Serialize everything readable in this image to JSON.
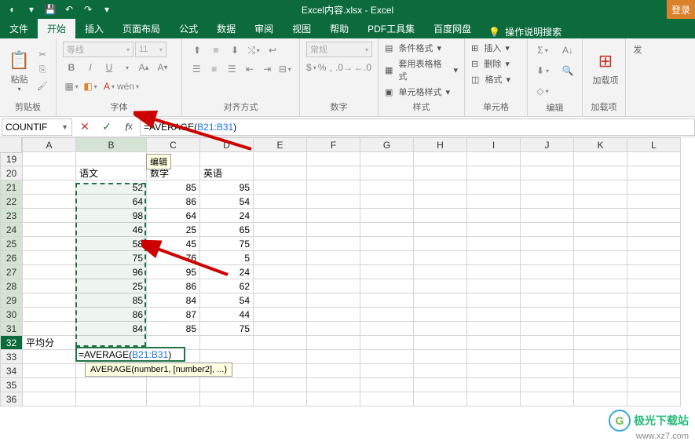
{
  "app": {
    "title": "Excel内容.xlsx - Excel",
    "login": "登录"
  },
  "tabs": {
    "file": "文件",
    "home": "开始",
    "insert": "插入",
    "layout": "页面布局",
    "formula": "公式",
    "data": "数据",
    "review": "审阅",
    "view": "视图",
    "help": "帮助",
    "pdf": "PDF工具集",
    "baidu": "百度网盘",
    "search": "操作说明搜索"
  },
  "ribbon": {
    "clipboard": {
      "label": "剪贴板",
      "paste": "粘贴"
    },
    "font": {
      "label": "字体",
      "name": "等线",
      "size": "11"
    },
    "align": {
      "label": "对齐方式"
    },
    "number": {
      "label": "数字",
      "format": "常规"
    },
    "styles": {
      "label": "样式",
      "cond": "条件格式",
      "table": "套用表格格式",
      "cell": "单元格样式"
    },
    "cells": {
      "label": "单元格",
      "insert": "插入",
      "delete": "删除",
      "format": "格式"
    },
    "edit": {
      "label": "编辑"
    },
    "addins": {
      "label": "加载项",
      "btn": "加载项"
    },
    "publish": {
      "label": "发"
    }
  },
  "formulaBar": {
    "name": "COUNTIF",
    "formula_pre": "=AVERAGE(",
    "formula_sel": "B21:B31",
    "formula_post": ")",
    "edit_tip": "编辑",
    "hint": "AVERAGE(number1, [number2], ...)"
  },
  "grid": {
    "cols": [
      "A",
      "B",
      "C",
      "D",
      "E",
      "F",
      "G",
      "H",
      "I",
      "J",
      "K",
      "L"
    ],
    "rows": [
      {
        "n": 19,
        "A": "",
        "B": "",
        "C": "",
        "D": ""
      },
      {
        "n": 20,
        "A": "",
        "B": "语文",
        "C": "数学",
        "D": "英语"
      },
      {
        "n": 21,
        "A": "",
        "B": "52",
        "C": "85",
        "D": "95"
      },
      {
        "n": 22,
        "A": "",
        "B": "64",
        "C": "86",
        "D": "54"
      },
      {
        "n": 23,
        "A": "",
        "B": "98",
        "C": "64",
        "D": "24"
      },
      {
        "n": 24,
        "A": "",
        "B": "46",
        "C": "25",
        "D": "65"
      },
      {
        "n": 25,
        "A": "",
        "B": "58",
        "C": "45",
        "D": "75"
      },
      {
        "n": 26,
        "A": "",
        "B": "75",
        "C": "76",
        "D": "5"
      },
      {
        "n": 27,
        "A": "",
        "B": "96",
        "C": "95",
        "D": "24"
      },
      {
        "n": 28,
        "A": "",
        "B": "25",
        "C": "86",
        "D": "62"
      },
      {
        "n": 29,
        "A": "",
        "B": "85",
        "C": "84",
        "D": "54"
      },
      {
        "n": 30,
        "A": "",
        "B": "86",
        "C": "87",
        "D": "44"
      },
      {
        "n": 31,
        "A": "",
        "B": "84",
        "C": "85",
        "D": "75"
      },
      {
        "n": 32,
        "A": "平均分",
        "B": "",
        "C": "",
        "D": ""
      },
      {
        "n": 33,
        "A": "",
        "B": "",
        "C": "",
        "D": ""
      },
      {
        "n": 34,
        "A": "",
        "B": "",
        "C": "",
        "D": ""
      },
      {
        "n": 35,
        "A": "",
        "B": "",
        "C": "",
        "D": ""
      },
      {
        "n": 36,
        "A": "",
        "B": "",
        "C": "",
        "D": ""
      }
    ],
    "active_value_pre": "=AVERAGE(",
    "active_value_sel": "B21:B31",
    "active_value_post": ")"
  },
  "watermark": {
    "cn": "极光下载站",
    "url": "www.xz7.com"
  },
  "colors": {
    "brand": "#0c6b3d",
    "accent": "#217346"
  }
}
